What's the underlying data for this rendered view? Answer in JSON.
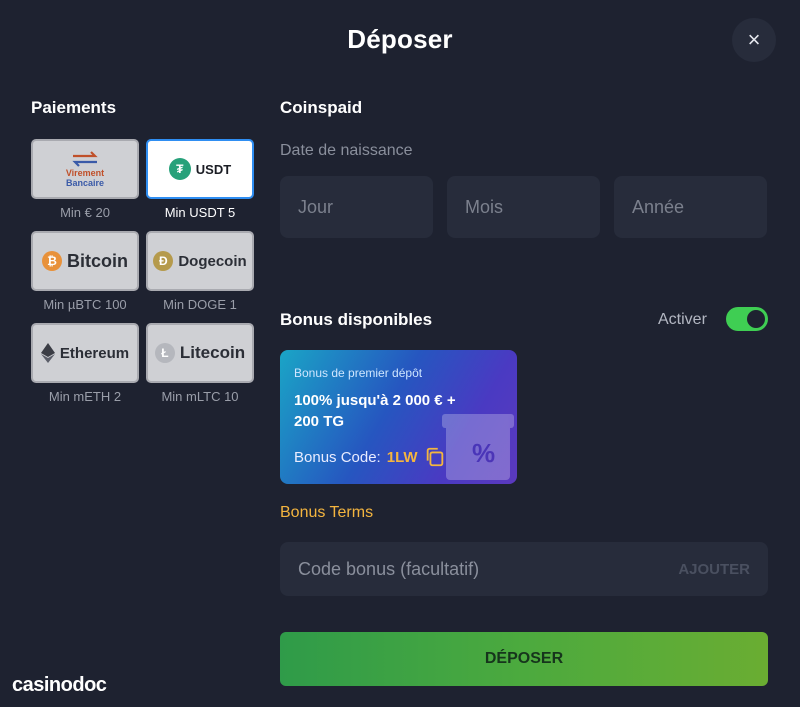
{
  "header": {
    "title": "Déposer",
    "close_label": "×"
  },
  "payments": {
    "title": "Paiements",
    "methods": [
      {
        "label_top": "Virement",
        "label_bottom": "Bancaire",
        "min": "Min € 20",
        "selected": false
      },
      {
        "label": "USDT",
        "min": "Min USDT 5",
        "selected": true
      },
      {
        "label": "Bitcoin",
        "min": "Min µBTC 100",
        "selected": false
      },
      {
        "label": "Dogecoin",
        "min": "Min DOGE 1",
        "selected": false
      },
      {
        "label": "Ethereum",
        "min": "Min mETH 2",
        "selected": false
      },
      {
        "label": "Litecoin",
        "min": "Min mLTC 10",
        "selected": false
      }
    ]
  },
  "form": {
    "provider": "Coinspaid",
    "dob_label": "Date de naissance",
    "dob_placeholders": {
      "day": "Jour",
      "month": "Mois",
      "year": "Année"
    }
  },
  "bonus": {
    "title": "Bonus disponibles",
    "toggle_label": "Activer",
    "toggle_on": true,
    "card": {
      "subtitle": "Bonus de premier dépôt",
      "main": "100% jusqu'à 2 000 € + 200 TG",
      "code_label": "Bonus Code:",
      "code_value": "1LW"
    },
    "terms_link": "Bonus Terms"
  },
  "code_input": {
    "placeholder": "Code bonus (facultatif)",
    "add_label": "AJOUTER"
  },
  "submit": {
    "label": "DÉPOSER"
  },
  "watermark": {
    "text": "casinodoc"
  },
  "colors": {
    "background": "#1e2230",
    "field": "#272c3b",
    "accent_gold": "#f4b53f",
    "toggle_green": "#3fce53",
    "selected_border": "#2f8ef2"
  }
}
